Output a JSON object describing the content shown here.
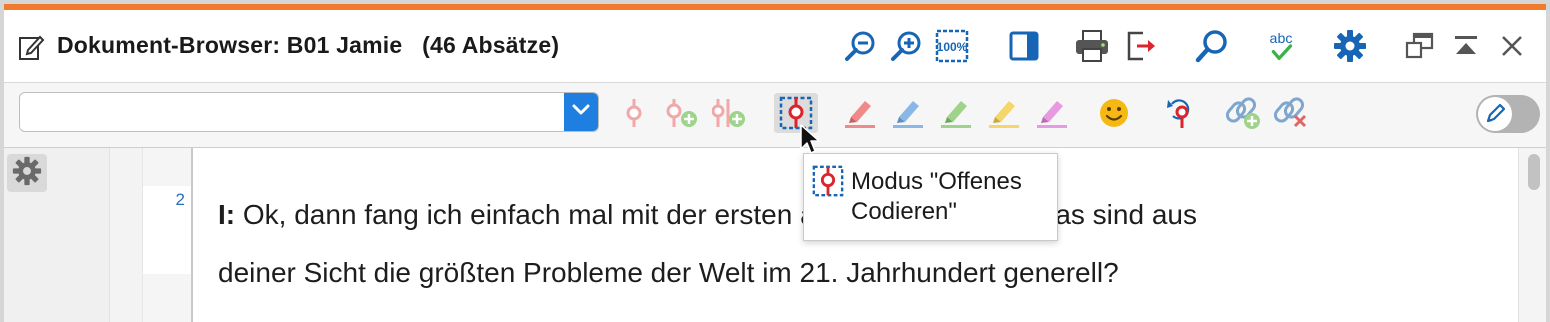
{
  "window": {
    "title": "Dokument-Browser: B01 Jamie   (46 Absätze)",
    "accent_color": "#f07b2c",
    "title_icon": "edit-document-icon"
  },
  "header_icons": [
    "zoom-out-icon",
    "zoom-in-icon",
    "zoom-100-icon",
    "sidebar-toggle-icon",
    "print-icon",
    "export-icon",
    "search-icon",
    "spellcheck-icon",
    "settings-gear-icon",
    "undock-window-icon",
    "collapse-up-icon",
    "close-icon"
  ],
  "header_labels": {
    "zoom100": "100%",
    "spellcheck": "abc"
  },
  "toolbar": {
    "code_combo_value": "",
    "code_combo_placeholder": "",
    "icons": [
      "code-icon",
      "code-add-icon",
      "multi-code-add-icon",
      "open-coding-mode-icon",
      "highlighter-red-icon",
      "highlighter-blue-icon",
      "highlighter-green-icon",
      "highlighter-yellow-icon",
      "highlighter-magenta-icon",
      "emoticon-icon",
      "undo-coding-icon",
      "link-add-icon",
      "link-remove-icon"
    ],
    "edit_toggle": "edit-mode-toggle-icon",
    "highlight_colors": [
      "#f08a8a",
      "#8ab8e6",
      "#9ed38a",
      "#f5d66a",
      "#e79ae0"
    ],
    "code_color": "#d9252b"
  },
  "document": {
    "paragraph_number": "2",
    "speaker": "I:",
    "text_line1_part1": " Ok, dann fang ich einfach mal mit der ersten ",
    "text_line1_part2": "an. Und die lautet, was sind aus",
    "text_line2": "deiner Sicht die größten Probleme der Welt im 21. Jahrhundert generell?"
  },
  "tooltip": {
    "text": "Modus \"Offenes\nCodieren\""
  }
}
